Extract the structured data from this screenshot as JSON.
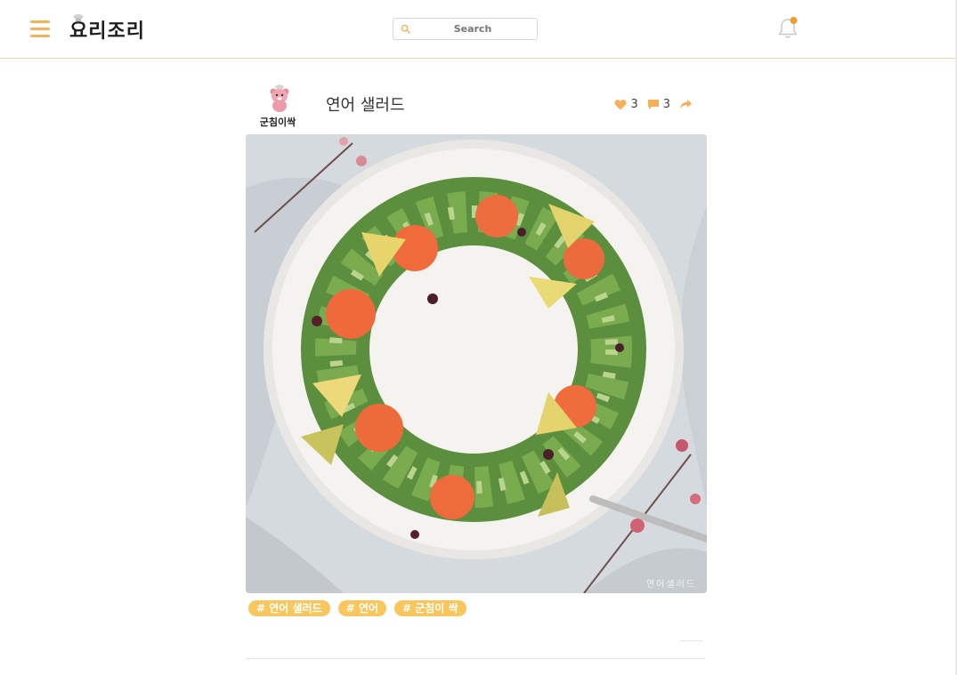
{
  "header": {
    "logo_text": "요리조리",
    "search_placeholder": "Search"
  },
  "post": {
    "author_name": "군침이싹",
    "title": "연어 샐러드",
    "likes": "3",
    "comments": "3",
    "image_watermark": "연어샐러드",
    "tags": [
      "# 연어 샐러드",
      "# 연어",
      "# 군침이 싹"
    ]
  },
  "colors": {
    "accent": "#f5b157",
    "tag_bg": "#f9c65c",
    "notification_dot": "#f39c2b",
    "header_border": "#f5d7a6"
  },
  "icons": {
    "menu": "hamburger-menu-icon",
    "search": "search-icon",
    "notifications": "bell-icon",
    "like": "heart-icon",
    "comment": "comment-icon",
    "share": "share-arrow-icon"
  }
}
